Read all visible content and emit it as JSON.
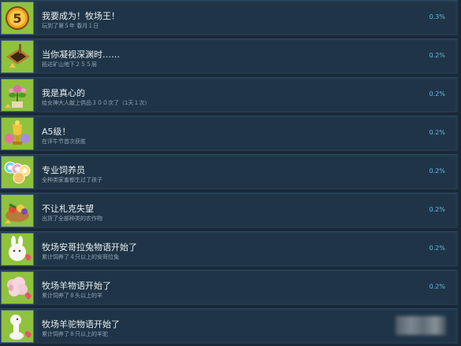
{
  "achievements": [
    {
      "title": "我要成为！牧场王！",
      "desc": "玩到了第５年 春月１日",
      "pct": "0.3%",
      "icon": "gold-medal-5-icon",
      "icon_bg": "#8fc23e"
    },
    {
      "title": "当你凝视深渊时……",
      "desc": "抵达矿山地下２５５层",
      "pct": "0.2%",
      "icon": "mine-hole-icon",
      "icon_bg": "#8fc23e"
    },
    {
      "title": "我是真心的",
      "desc": "给女神大人献上供品３００次了（1天１次）",
      "pct": "0.2%",
      "icon": "flower-pot-icon",
      "icon_bg": "#8fc23e"
    },
    {
      "title": "A5级！",
      "desc": "在评牛节首次获胜",
      "pct": "0.2%",
      "icon": "trophy-icon",
      "icon_bg": "#8fc23e"
    },
    {
      "title": "专业饲养员",
      "desc": "全种类家畜都生过了孩子",
      "pct": "0.2%",
      "icon": "ribbons-icon",
      "icon_bg": "#8fc23e"
    },
    {
      "title": "不让札克失望",
      "desc": "出货了全部种类的农作物",
      "pct": "0.2%",
      "icon": "vegetable-basket-icon",
      "icon_bg": "#8fc23e"
    },
    {
      "title": "牧场安哥拉兔物语开始了",
      "desc": "累计饲养了４只以上的安哥拉兔",
      "pct": "0.2%",
      "icon": "angora-rabbit-icon",
      "icon_bg": "#8fc23e"
    },
    {
      "title": "牧场羊物语开始了",
      "desc": "累计饲养了８头以上的羊",
      "pct": "0.2%",
      "icon": "sheep-icon",
      "icon_bg": "#8fc23e"
    },
    {
      "title": "牧场羊驼物语开始了",
      "desc": "累计饲养了８只以上的羊驼",
      "pct": "",
      "icon": "alpaca-icon",
      "icon_bg": "#8fc23e"
    }
  ]
}
